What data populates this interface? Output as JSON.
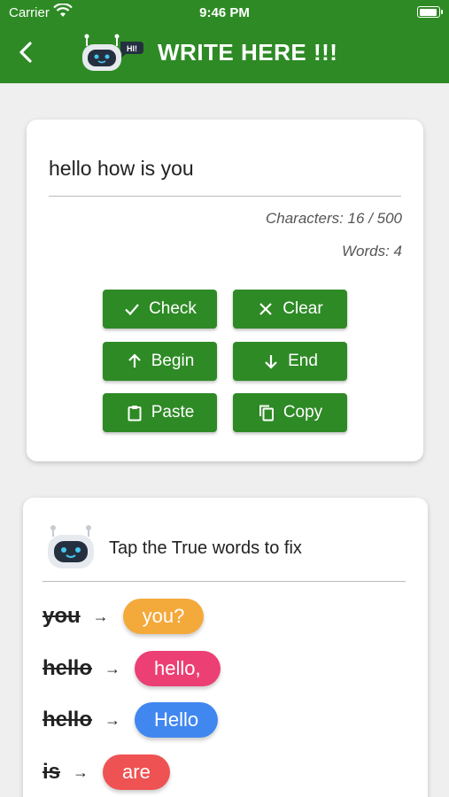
{
  "status_bar": {
    "carrier": "Carrier",
    "time": "9:46 PM"
  },
  "header": {
    "title": "WRITE HERE !!!",
    "logo_badge": "HI!"
  },
  "editor": {
    "text": "hello how is you",
    "characters": "Characters: 16 / 500",
    "words": "Words: 4"
  },
  "buttons": {
    "check": "Check",
    "clear": "Clear",
    "begin": "Begin",
    "end": "End",
    "paste": "Paste",
    "copy": "Copy"
  },
  "suggestions": {
    "instruction": "Tap the True words to fix",
    "items": [
      {
        "wrong": "you",
        "arrow": "→",
        "fix": "you?",
        "color": "#f4a93b"
      },
      {
        "wrong": "hello",
        "arrow": "→",
        "fix": "hello,",
        "color": "#ec3f74"
      },
      {
        "wrong": "hello",
        "arrow": "→",
        "fix": "Hello",
        "color": "#4187f0"
      },
      {
        "wrong": "is",
        "arrow": "→",
        "fix": "are",
        "color": "#ef5252"
      }
    ]
  },
  "colors": {
    "brand_green": "#2e8a25",
    "background": "#efefef"
  }
}
